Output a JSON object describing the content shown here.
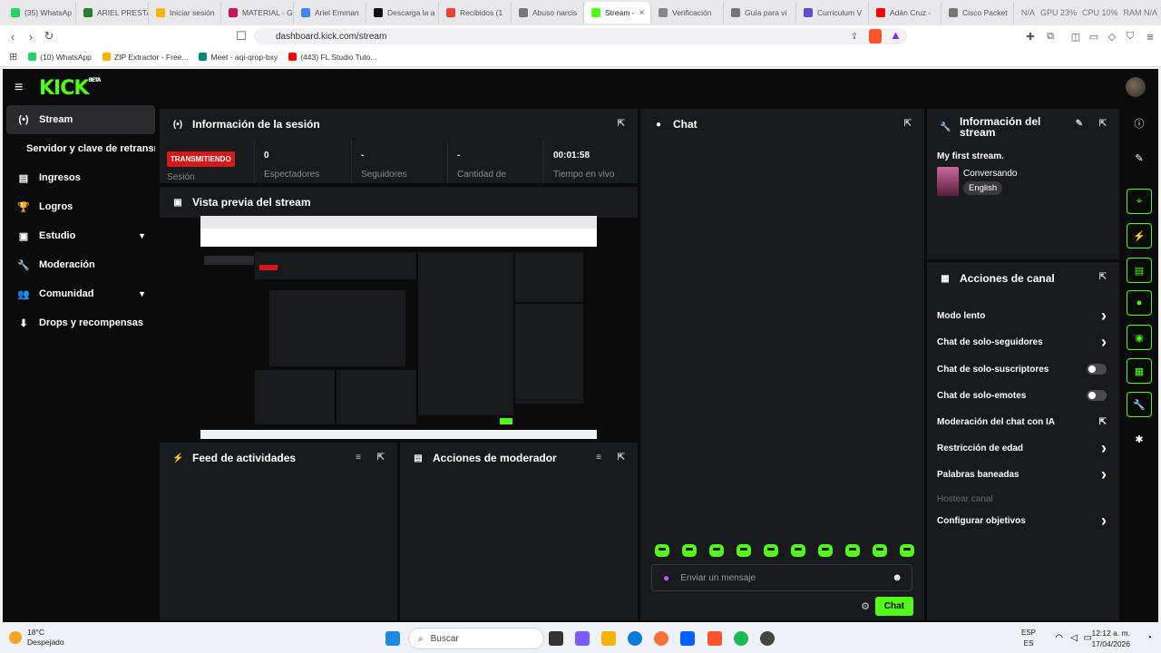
{
  "browser": {
    "tabs": [
      {
        "label": "(35) WhatsAp",
        "color": "#25d366"
      },
      {
        "label": "ARIEL PRESTA",
        "color": "#2e7d32"
      },
      {
        "label": "Iniciar sesión",
        "color": "#f4b400"
      },
      {
        "label": "MATERIAL - G",
        "color": "#c2185b"
      },
      {
        "label": "Ariel Emman",
        "color": "#4285f4"
      },
      {
        "label": "Descarga la a",
        "color": "#111111"
      },
      {
        "label": "Recibidos (1",
        "color": "#ea4335"
      },
      {
        "label": "Abuso narcis",
        "color": "#777777"
      },
      {
        "label": "Stream -",
        "color": "#53fc18",
        "active": true
      },
      {
        "label": "Verificación",
        "color": "#888888"
      },
      {
        "label": "Guía para vi",
        "color": "#777777"
      },
      {
        "label": "Curriculum V",
        "color": "#5a4fcf"
      },
      {
        "label": "Adán Cruz -",
        "color": "#ff0000"
      },
      {
        "label": "Cisco Packet",
        "color": "#777777"
      }
    ],
    "sys_stats": [
      "N/A",
      "GPU 23%",
      "CPU 10%",
      "RAM N/A"
    ],
    "url": "dashboard.kick.com/stream",
    "bookmarks": [
      {
        "label": "(10) WhatsApp",
        "color": "#25d366"
      },
      {
        "label": "ZIP Extractor - Free...",
        "color": "#f4b400"
      },
      {
        "label": "Meet - aqi-qrop-bxy",
        "color": "#00897b"
      },
      {
        "label": "(443) FL Studio Tuto...",
        "color": "#ff0000"
      }
    ]
  },
  "app": {
    "logo": "KICK",
    "logo_badge": "BETA",
    "accent": "#53fc18",
    "sidebar": [
      {
        "label": "Stream",
        "icon": "broadcast-icon",
        "glyph": "(•)",
        "active": true
      },
      {
        "label": "Servidor y clave de retransm",
        "sub": true
      },
      {
        "label": "Ingresos",
        "icon": "revenue-icon",
        "glyph": "▤"
      },
      {
        "label": "Logros",
        "icon": "trophy-icon",
        "glyph": "🏆"
      },
      {
        "label": "Estudio",
        "icon": "studio-icon",
        "glyph": "▣",
        "chevron": true
      },
      {
        "label": "Moderación",
        "icon": "wrench-icon",
        "glyph": "🔧"
      },
      {
        "label": "Comunidad",
        "icon": "community-icon",
        "glyph": "👥",
        "chevron": true
      },
      {
        "label": "Drops y recompensas",
        "icon": "drops-icon",
        "glyph": "⬇"
      }
    ],
    "session": {
      "title": "Información de la sesión",
      "badge": "TRANSMITIENDO",
      "badge_label": "Sesión",
      "stats": [
        {
          "value": "0",
          "label": "Espectadores"
        },
        {
          "value": "-",
          "label": "Seguidores"
        },
        {
          "value": "-",
          "label": "Cantidad de"
        },
        {
          "value": "00:01:58",
          "label": "Tiempo en vivo"
        }
      ]
    },
    "preview": {
      "title": "Vista previa del stream"
    },
    "feed": {
      "title": "Feed de actividades"
    },
    "mod_actions": {
      "title": "Acciones de moderador"
    },
    "chat": {
      "title": "Chat",
      "placeholder": "Enviar un mensaje",
      "send": "Chat"
    },
    "stream_info": {
      "title": "Información del stream",
      "stream_title": "My first stream.",
      "category": "Conversando",
      "language": "English"
    },
    "channel_actions": {
      "title": "Acciones de canal",
      "items": [
        {
          "label": "Modo lento",
          "kind": "arrow"
        },
        {
          "label": "Chat de solo-seguidores",
          "kind": "arrow"
        },
        {
          "label": "Chat de solo-suscriptores",
          "kind": "toggle"
        },
        {
          "label": "Chat de solo-emotes",
          "kind": "toggle"
        },
        {
          "label": "Moderación del chat con IA",
          "kind": "external"
        },
        {
          "label": "Restricción de edad",
          "kind": "arrow"
        },
        {
          "label": "Palabras baneadas",
          "kind": "arrow"
        },
        {
          "label": "Hostear canal",
          "kind": "disabled"
        },
        {
          "label": "Configurar objetivos",
          "kind": "arrow"
        }
      ]
    }
  },
  "taskbar": {
    "temp": "18°C",
    "weather": "Despejado",
    "search": "Buscar",
    "lang_top": "ESP",
    "lang_bottom": "ES",
    "time": "12:12 a. m.",
    "date": "17/04/2026"
  }
}
